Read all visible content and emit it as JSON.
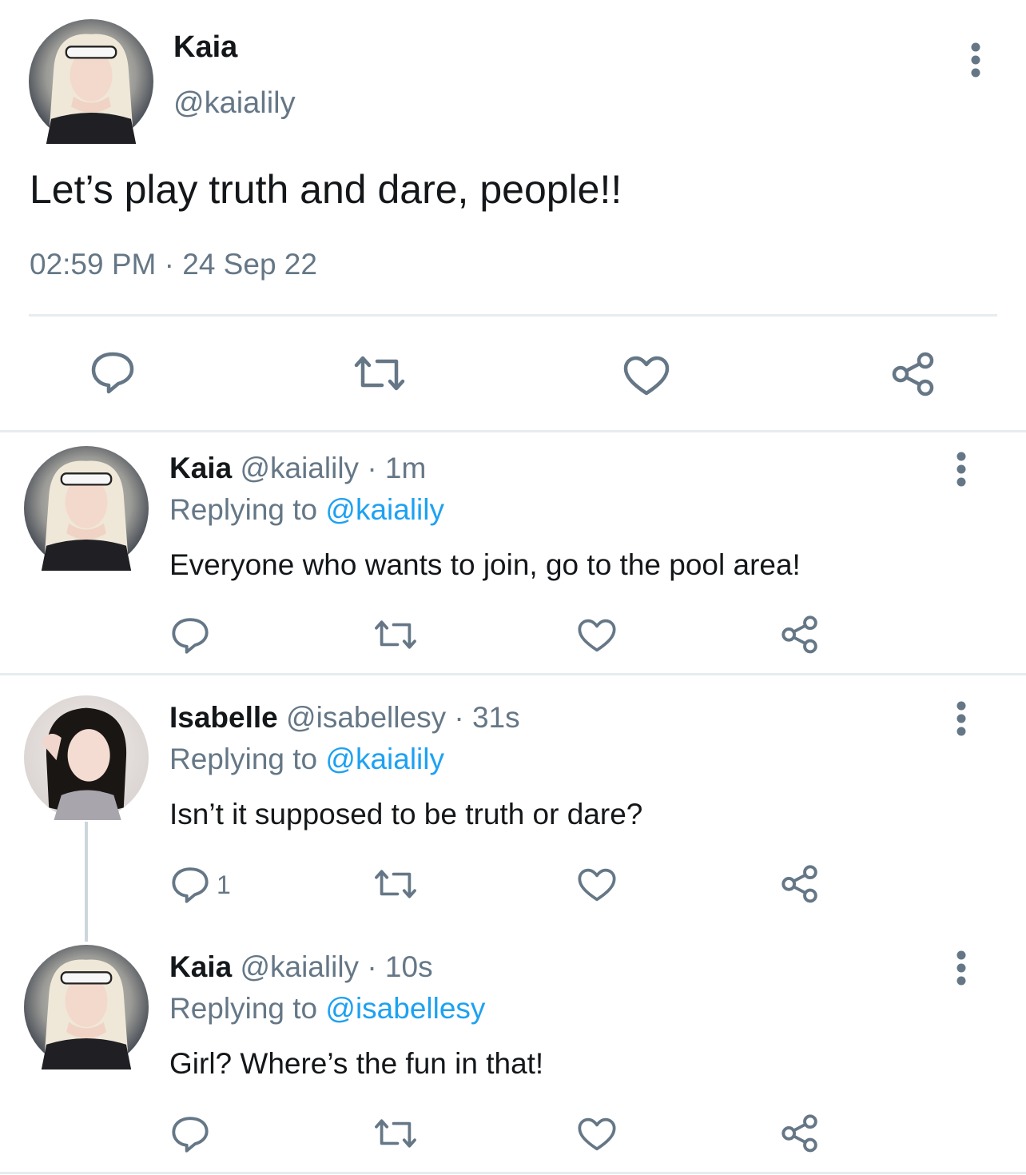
{
  "main_tweet": {
    "display_name": "Kaia",
    "handle": "@kaialily",
    "text": "Let’s play truth and dare, people!!",
    "timestamp": "02:59 PM · 24 Sep 22",
    "actions": [
      "reply-icon",
      "retweet-icon",
      "like-icon",
      "share-icon"
    ]
  },
  "replies": [
    {
      "display_name": "Kaia",
      "handle": "@kaialily",
      "time": "· 1m",
      "replying_prefix": "Replying to",
      "replying_to": "@kaialily",
      "text": "Everyone who wants to join, go to the pool area!",
      "reply_count": ""
    },
    {
      "display_name": "Isabelle",
      "handle": "@isabellesy",
      "time": "· 31s",
      "replying_prefix": "Replying to",
      "replying_to": "@kaialily",
      "text": "Isn’t it supposed to be truth or dare?",
      "reply_count": "1"
    },
    {
      "display_name": "Kaia",
      "handle": "@kaialily",
      "time": "· 10s",
      "replying_prefix": "Replying to",
      "replying_to": "@isabellesy",
      "text": "Girl? Where’s the fun in that!",
      "reply_count": ""
    }
  ],
  "colors": {
    "text_primary": "#14171a",
    "text_secondary": "#657786",
    "link": "#1da1f2",
    "divider": "#e6ecf0",
    "icon": "#657786"
  }
}
